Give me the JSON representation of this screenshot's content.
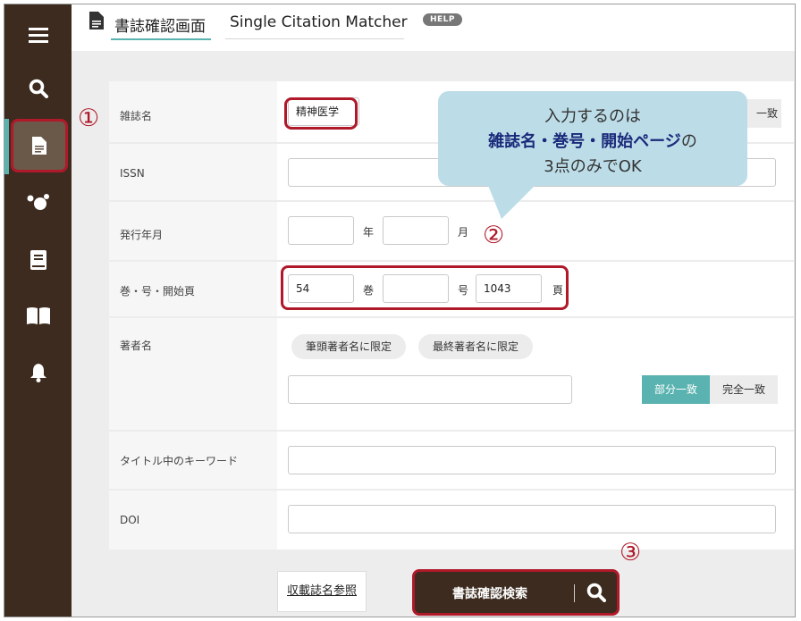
{
  "header": {
    "tab_ja": "書誌確認画面",
    "tab_en": "Single Citation Matcher",
    "help": "HELP"
  },
  "sidebar": {
    "items": [
      {
        "icon": "menu-icon"
      },
      {
        "icon": "search-icon"
      },
      {
        "icon": "document-icon"
      },
      {
        "icon": "molecule-icon"
      },
      {
        "icon": "book-icon"
      },
      {
        "icon": "open-book-icon"
      },
      {
        "icon": "bell-icon"
      }
    ]
  },
  "form": {
    "journal": {
      "label": "雑誌名",
      "value": "精神医学",
      "match_partial": "一致"
    },
    "issn": {
      "label": "ISSN",
      "value": ""
    },
    "pubdate": {
      "label": "発行年月",
      "year_value": "",
      "year_unit": "年",
      "month_value": "",
      "month_unit": "月"
    },
    "volume": {
      "label": "巻・号・開始頁",
      "volume_value": "54",
      "volume_unit": "巻",
      "issue_value": "",
      "issue_unit": "号",
      "page_value": "1043",
      "page_unit": "頁"
    },
    "author": {
      "label": "著者名",
      "first_author": "筆頭著者名に限定",
      "last_author": "最終著者名に限定",
      "value": "",
      "partial": "部分一致",
      "exact": "完全一致"
    },
    "keyword": {
      "label": "タイトル中のキーワード",
      "value": ""
    },
    "doi": {
      "label": "DOI",
      "value": ""
    }
  },
  "annotations": {
    "n1": "①",
    "n2": "②",
    "n3": "③",
    "tooltip_line1": "入力するのは",
    "tooltip_line2_bold": "雑誌名・巻号・開始ページ",
    "tooltip_line2_rest": "の",
    "tooltip_line3": "3点のみでOK"
  },
  "buttons": {
    "browse": "収載誌名参照",
    "search": "書誌確認検索"
  },
  "colors": {
    "sidebar": "#3d2b1f",
    "accent": "#5ab3b0",
    "highlight": "#b0192a",
    "tooltip": "#bcdde8"
  }
}
